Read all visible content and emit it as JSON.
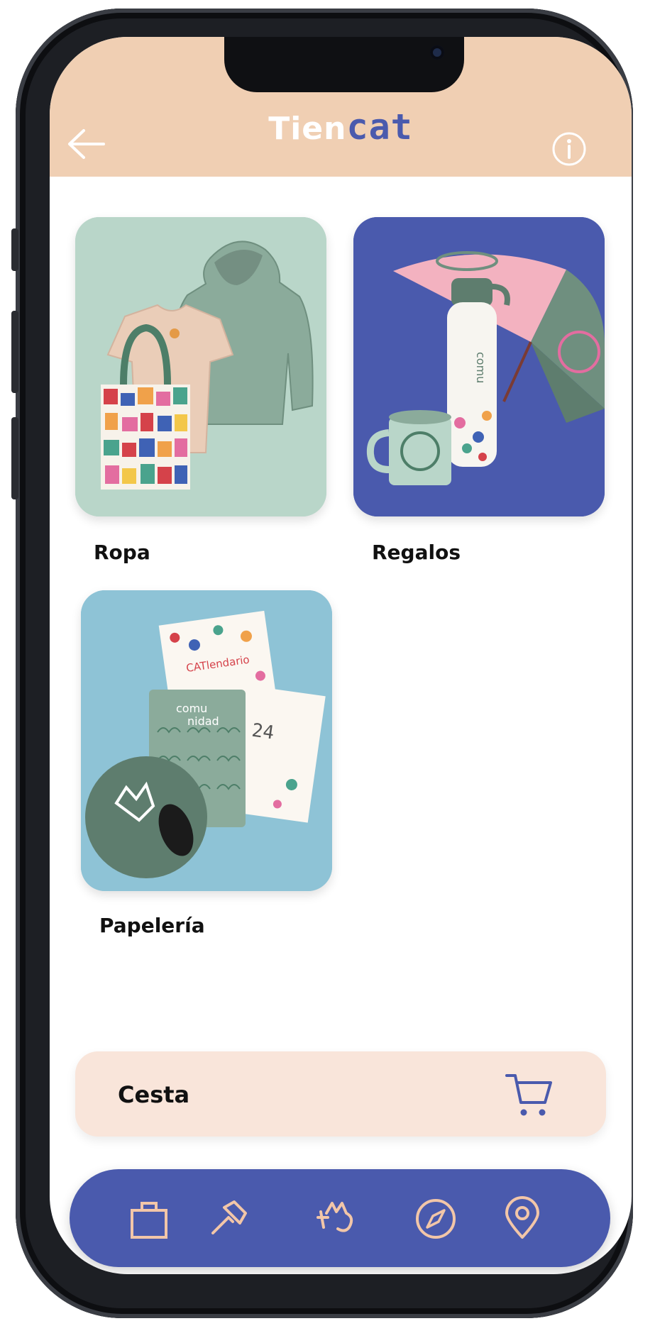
{
  "header": {
    "title_prefix": "Tien",
    "title_suffix": "cat"
  },
  "categories": [
    {
      "label": "Ropa"
    },
    {
      "label": "Regalos"
    },
    {
      "label": "Papelería"
    }
  ],
  "products": {
    "calendar_text": "CATlendario",
    "notebook_text_1": "comu",
    "notebook_text_2": "nidad"
  },
  "cart": {
    "label": "Cesta"
  },
  "nav": {
    "items": [
      {
        "icon": "shopping-bag-icon"
      },
      {
        "icon": "hammer-icon"
      },
      {
        "icon": "cat-logo-icon"
      },
      {
        "icon": "compass-icon"
      },
      {
        "icon": "location-pin-icon"
      }
    ]
  },
  "colors": {
    "header_bg": "#f0cfb3",
    "accent_blue": "#4a5aad",
    "cart_bg": "#f9e5da",
    "nav_icon": "#f2c6a8"
  }
}
